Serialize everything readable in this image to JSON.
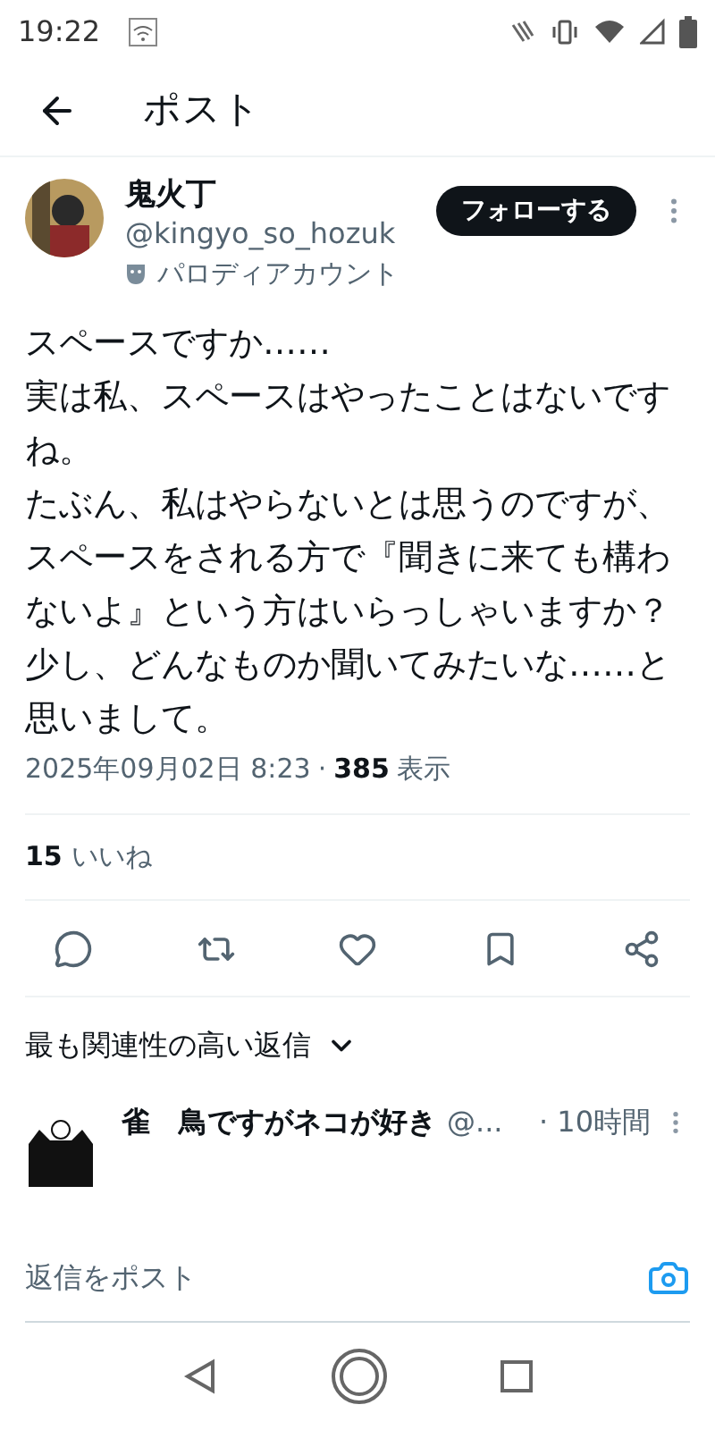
{
  "status_bar": {
    "time": "19:22"
  },
  "header": {
    "title": "ポスト"
  },
  "post": {
    "author": {
      "name": "鬼火丁",
      "handle": "@kingyo_so_hozuk",
      "label": "パロディアカウント"
    },
    "follow_button": "フォローする",
    "paragraphs": [
      "スペースですか……",
      "実は私、スペースはやったことはないですね。",
      "たぶん、私はやらないとは思うのですが、スペースをされる方で『聞きに来ても構わないよ』という方はいらっしゃいますか？",
      "少し、どんなものか聞いてみたいな……と思いまして。"
    ],
    "timestamp": "2025年09月02日 8:23",
    "separator": "·",
    "views_count": "385",
    "views_label": "表示",
    "likes_count": "15",
    "likes_label": "いいね",
    "actions": [
      {
        "kind": "reply"
      },
      {
        "kind": "repost"
      },
      {
        "kind": "like"
      },
      {
        "kind": "bookmark"
      },
      {
        "kind": "share"
      }
    ]
  },
  "replies_sort": {
    "label": "最も関連性の高い返信"
  },
  "replies": [
    {
      "name": "雀　鳥ですがネコが好き",
      "handle": "@...",
      "time": "· 10時間"
    }
  ],
  "composer": {
    "placeholder": "返信をポスト"
  }
}
